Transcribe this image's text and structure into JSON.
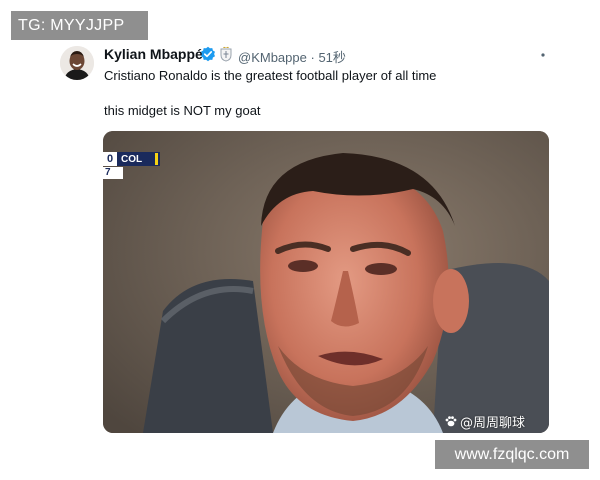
{
  "watermarks": {
    "top_left": "TG: MYYJJPP",
    "bottom_right": "www.fzqlqc.com"
  },
  "tweet": {
    "author_name": "Kylian Mbappé",
    "handle": "@KMbappe",
    "separator": "·",
    "time": "51秒",
    "text_line1": "Cristiano Ronaldo is the greatest football player of all time",
    "text_line2": "this midget is NOT my goat",
    "verified_color": "#1d9bf0",
    "icons": [
      "avatar",
      "verified-badge-icon",
      "club-badge-icon",
      "more-options-icon"
    ]
  },
  "media": {
    "scorebug": {
      "score": "0",
      "team": "COL",
      "sub_value": "7"
    },
    "credit_icon": "paw-icon",
    "credit_text": "@周周聊球"
  }
}
